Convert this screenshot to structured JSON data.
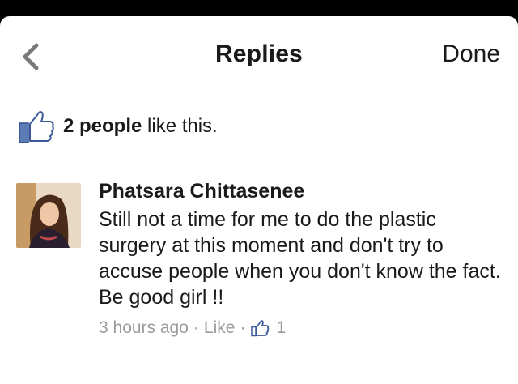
{
  "header": {
    "title": "Replies",
    "done_label": "Done",
    "back_icon": "chevron-left-icon"
  },
  "likes": {
    "icon": "thumbs-up-icon",
    "count_text": "2 people",
    "suffix_text": " like this."
  },
  "comment": {
    "author": "Phatsara Chittasenee",
    "text": "Still not a time for me to do the plastic surgery at this moment and don't try to accuse people when you don't know the fact.  Be good girl !!",
    "time": "3 hours ago",
    "sep1": "·",
    "like_label": "Like",
    "sep2": "·",
    "like_count": "1"
  },
  "colors": {
    "accent_blue": "#3b5998",
    "meta_gray": "#9b9b9b"
  }
}
